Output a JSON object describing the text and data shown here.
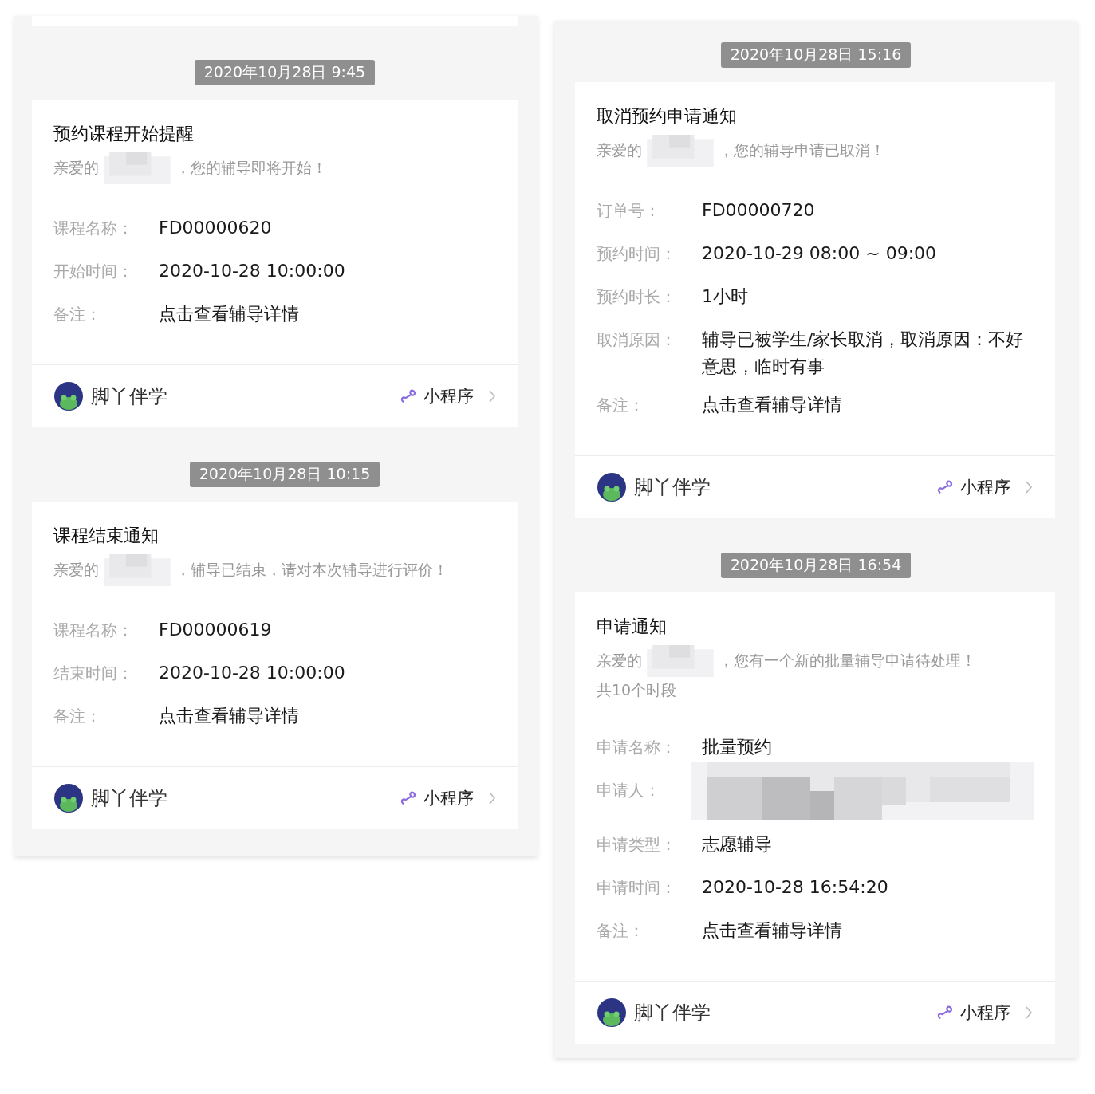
{
  "columns": [
    {
      "clipped_card_above": true,
      "messages": [
        {
          "timestamp": "2020年10月28日 9:45",
          "title": "预约课程开始提醒",
          "greeting": {
            "before": "亲爱的",
            "after": "，您的辅导即将开始！"
          },
          "fields": [
            {
              "kind": "text",
              "label": "课程名称：",
              "value": "FD00000620"
            },
            {
              "kind": "text",
              "label": "开始时间：",
              "value": "2020-10-28 10:00:00"
            },
            {
              "kind": "text",
              "label": "备注：",
              "value": "点击查看辅导详情"
            }
          ],
          "footer": {
            "app_name": "脚丫伴学",
            "link": "小程序"
          }
        },
        {
          "timestamp": "2020年10月28日 10:15",
          "title": "课程结束通知",
          "greeting": {
            "before": "亲爱的",
            "after": "，辅导已结束，请对本次辅导进行评价！"
          },
          "fields": [
            {
              "kind": "text",
              "label": "课程名称：",
              "value": "FD00000619"
            },
            {
              "kind": "text",
              "label": "结束时间：",
              "value": "2020-10-28 10:00:00"
            },
            {
              "kind": "text",
              "label": "备注：",
              "value": "点击查看辅导详情"
            }
          ],
          "footer": {
            "app_name": "脚丫伴学",
            "link": "小程序"
          }
        }
      ]
    },
    {
      "clipped_card_above": false,
      "messages": [
        {
          "timestamp": "2020年10月28日 15:16",
          "title": "取消预约申请通知",
          "greeting": {
            "before": "亲爱的",
            "after": "，您的辅导申请已取消！"
          },
          "fields": [
            {
              "kind": "text",
              "label": "订单号：",
              "value": "FD00000720"
            },
            {
              "kind": "text",
              "label": "预约时间：",
              "value": "2020-10-29 08:00 ~ 09:00"
            },
            {
              "kind": "text",
              "label": "预约时长：",
              "value": "1小时"
            },
            {
              "kind": "text",
              "label": "取消原因：",
              "value": "辅导已被学生/家长取消，取消原因：不好意思，临时有事"
            },
            {
              "kind": "text",
              "label": "备注：",
              "value": "点击查看辅导详情"
            }
          ],
          "footer": {
            "app_name": "脚丫伴学",
            "link": "小程序"
          }
        },
        {
          "timestamp": "2020年10月28日 16:54",
          "title": "申请通知",
          "greeting": {
            "before": "亲爱的",
            "after": "，您有一个新的批量辅导申请待处理！"
          },
          "note": "共10个时段",
          "fields": [
            {
              "kind": "text",
              "label": "申请名称：",
              "value": "批量预约"
            },
            {
              "kind": "redacted",
              "label": "申请人："
            },
            {
              "kind": "text",
              "label": "申请类型：",
              "value": "志愿辅导"
            },
            {
              "kind": "text",
              "label": "申请时间：",
              "value": "2020-10-28 16:54:20"
            },
            {
              "kind": "text",
              "label": "备注：",
              "value": "点击查看辅导详情"
            }
          ],
          "footer": {
            "app_name": "脚丫伴学",
            "link": "小程序"
          }
        }
      ]
    }
  ]
}
